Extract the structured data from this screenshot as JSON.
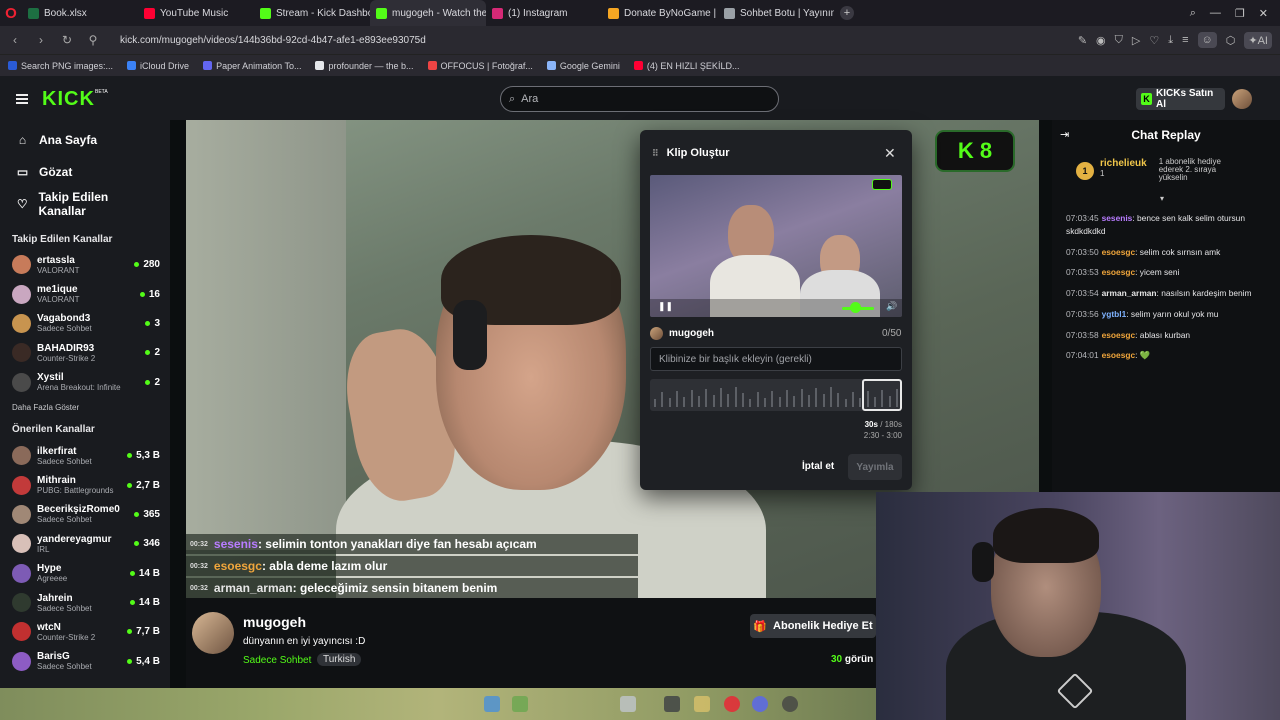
{
  "browser": {
    "tabs": [
      {
        "label": "Book.xlsx",
        "color": "#1d6f42"
      },
      {
        "label": "YouTube Music",
        "color": "#ff0033"
      },
      {
        "label": "Stream - Kick Dashboard",
        "color": "#53fc18"
      },
      {
        "label": "mugogeh - Watch the",
        "color": "#53fc18"
      },
      {
        "label": "(1) Instagram",
        "color": "#d62976"
      },
      {
        "label": "Donate ByNoGame | Strea",
        "color": "#f5a623"
      },
      {
        "label": "Sohbet Botu | Yayınını güç",
        "color": "#9aa0a6"
      }
    ],
    "url": "kick.com/mugogeh/videos/144b36bd-92cd-4b47-afe1-e893ee93075d",
    "bookmarks": [
      {
        "label": "Search PNG images:...",
        "color": "#2a5bd7"
      },
      {
        "label": "iCloud Drive",
        "color": "#3b82f6"
      },
      {
        "label": "Paper Animation To...",
        "color": "#6366f1"
      },
      {
        "label": "profounder — the b...",
        "color": "#e5e7eb"
      },
      {
        "label": "OFFOCUS | Fotoğraf...",
        "color": "#ef4444"
      },
      {
        "label": "Google Gemini",
        "color": "#8ab4f8"
      },
      {
        "label": "(4) EN HIZLI ŞEKİLD...",
        "color": "#ff0033"
      }
    ]
  },
  "header": {
    "logo": "KICK",
    "beta": "BETA",
    "search_placeholder": "Ara",
    "kicks_button": "KICKs Satın Al"
  },
  "sidebar": {
    "nav": [
      {
        "label": "Ana Sayfa",
        "icon": "home-icon"
      },
      {
        "label": "Gözat",
        "icon": "browse-icon"
      },
      {
        "label": "Takip Edilen Kanallar",
        "icon": "heart-icon"
      }
    ],
    "followed_title": "Takip Edilen Kanallar",
    "followed": [
      {
        "name": "ertassla",
        "category": "VALORANT",
        "viewers": "280",
        "color": "#c77b5a"
      },
      {
        "name": "me1ique",
        "category": "VALORANT",
        "viewers": "16",
        "color": "#c9a7c0"
      },
      {
        "name": "Vagabond3",
        "category": "Sadece Sohbet",
        "viewers": "3",
        "color": "#c8944f"
      },
      {
        "name": "BAHADIR93",
        "category": "Counter-Strike 2",
        "viewers": "2",
        "color": "#3a2a25"
      },
      {
        "name": "Xystil",
        "category": "Arena Breakout: Infinite",
        "viewers": "2",
        "color": "#4a4a4a"
      }
    ],
    "show_more": "Daha Fazla Göster",
    "recommended_title": "Önerilen Kanallar",
    "recommended": [
      {
        "name": "ilkerfirat",
        "category": "Sadece Sohbet",
        "viewers": "5,3 B",
        "color": "#8a6a5a"
      },
      {
        "name": "Mithrain",
        "category": "PUBG: Battlegrounds",
        "viewers": "2,7 B",
        "color": "#c23a3a"
      },
      {
        "name": "BecerikşizRome0",
        "category": "Sadece Sohbet",
        "viewers": "365",
        "color": "#a08876"
      },
      {
        "name": "yandereyagmur",
        "category": "IRL",
        "viewers": "346",
        "color": "#d8c0b8"
      },
      {
        "name": "Hype",
        "category": "Agreeee",
        "viewers": "14 B",
        "color": "#7d5bb5"
      },
      {
        "name": "Jahrein",
        "category": "Sadece Sohbet",
        "viewers": "14 B",
        "color": "#2f3a2f"
      },
      {
        "name": "wtcN",
        "category": "Counter-Strike 2",
        "viewers": "7,7 B",
        "color": "#c23030"
      },
      {
        "name": "BarisG",
        "category": "Sadece Sohbet",
        "viewers": "5,4 B",
        "color": "#8d5cc4"
      }
    ]
  },
  "video": {
    "kick_badge_count": "8",
    "chat_overlay": [
      {
        "time": "00:32",
        "user": "sesenis",
        "user_color": "#b87cff",
        "text": ": selimin tonton yanakları diye fan hesabı açıcam"
      },
      {
        "time": "00:32",
        "user": "esoesgc",
        "user_color": "#f0a63c",
        "text": ": abla deme lazım olur"
      },
      {
        "time": "00:32",
        "user": "arman_arman",
        "user_color": "#e6e6e6",
        "text": ": geleceğimiz sensin bitanem benim"
      }
    ],
    "kick_badge_count_2": "3"
  },
  "clip_modal": {
    "title": "Klip Oluştur",
    "username": "mugogeh",
    "char_count": "0/50",
    "title_placeholder": "Klibinize bir başlık ekleyin (gerekli)",
    "duration_value": "30s",
    "duration_max": "/ 180s",
    "range": "2:30 - 3:00",
    "cancel_label": "İptal et",
    "publish_label": "Yayımla"
  },
  "stream": {
    "name": "mugogeh",
    "title": "dünyanın en iyi yayıncısı :D",
    "category": "Sadece Sohbet",
    "tag": "Turkish",
    "subscribe_gift": "Abonelik Hediye Et",
    "viewers_count": "30",
    "viewers_label": "görün"
  },
  "chat": {
    "title": "Chat Replay",
    "pinned_user": "richelieuk",
    "pinned_count": "1",
    "pinned_text": "1 abonelik hediye ederek 2. sıraya yükselin",
    "messages": [
      {
        "time": "07:03:45",
        "user": "sesenis",
        "color": "#b87cff",
        "text": ": bence sen kalk selim otursun skdkdkdkd"
      },
      {
        "time": "07:03:50",
        "user": "esoesgc",
        "color": "#f0a63c",
        "text": ": selim cok sırnsın amk"
      },
      {
        "time": "07:03:53",
        "user": "esoesgc",
        "color": "#f0a63c",
        "text": ": yicem seni"
      },
      {
        "time": "07:03:54",
        "user": "arman_arman",
        "color": "#e6e6e6",
        "text": ": nasılsın kardeşim benim"
      },
      {
        "time": "07:03:56",
        "user": "ygtbl1",
        "color": "#7fb3ff",
        "text": ": selim yarın okul yok mu"
      },
      {
        "time": "07:03:58",
        "user": "esoesgc",
        "color": "#f0a63c",
        "text": ": ablası kurban"
      },
      {
        "time": "07:04:01",
        "user": "esoesgc",
        "color": "#f0a63c",
        "text": ": 💚"
      }
    ]
  }
}
